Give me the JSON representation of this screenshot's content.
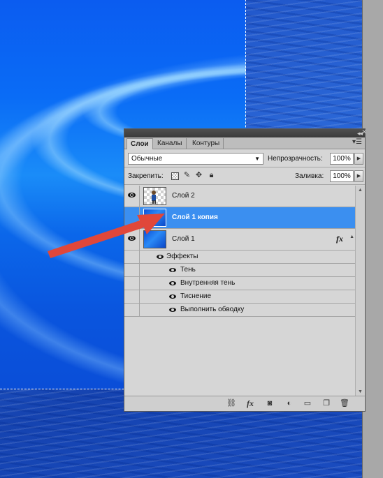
{
  "panel": {
    "tabs": [
      "Слои",
      "Каналы",
      "Контуры"
    ],
    "blend_mode": "Обычные",
    "opacity_label": "Непрозрачность:",
    "opacity_value": "100%",
    "lock_label": "Закрепить:",
    "fill_label": "Заливка:",
    "fill_value": "100%"
  },
  "layers": [
    {
      "name": "Слой 2",
      "thumb": "checker-with-figure",
      "selected": false
    },
    {
      "name": "Слой 1 копия",
      "thumb": "blue-water",
      "selected": true
    },
    {
      "name": "Слой 1",
      "thumb": "blue-water",
      "selected": false,
      "fx": "fx"
    }
  ],
  "effects": {
    "header": "Эффекты",
    "items": [
      "Тень",
      "Внутренняя тень",
      "Тиснение",
      "Выполнить обводку"
    ]
  },
  "icons": {
    "lock": [
      "lock-transparency-icon",
      "lock-brush-icon",
      "lock-move-icon",
      "lock-all-icon"
    ],
    "bottom": [
      "link-icon",
      "fx-icon",
      "mask-icon",
      "adjustment-icon",
      "group-folder-icon",
      "new-layer-icon",
      "trash-icon"
    ]
  },
  "colors": {
    "selection": "#3b8ff0",
    "annotation_arrow": "#e0473a"
  }
}
